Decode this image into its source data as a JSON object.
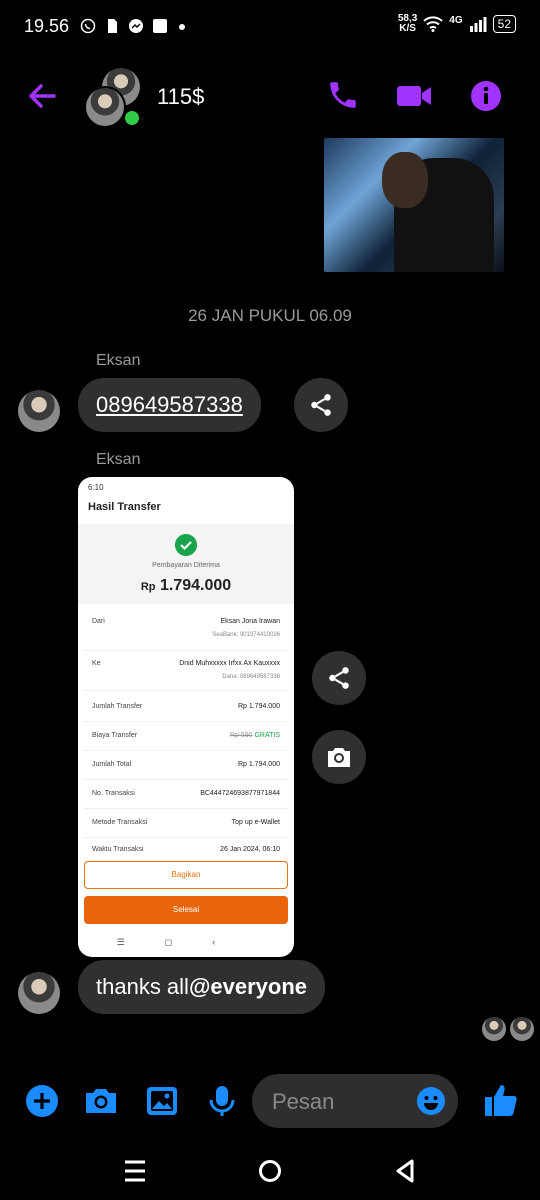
{
  "status_bar": {
    "time": "19.56",
    "net_speed_value": "58,3",
    "net_speed_unit": "K/S",
    "network": "4G",
    "battery": "52"
  },
  "header": {
    "title": "115$",
    "accent_color": "#a033ff"
  },
  "conversation": {
    "date_separator": "26 JAN PUKUL 06.09",
    "messages": [
      {
        "sender": "Eksan",
        "text": "089649587338"
      },
      {
        "sender": "Eksan",
        "type": "image"
      },
      {
        "text_plain": "thanks all",
        "text_mention": "@everyone"
      }
    ]
  },
  "receipt": {
    "status_time": "6:10",
    "title": "Hasil Transfer",
    "received_label": "Pembayaran Diterima",
    "amount_currency": "Rp",
    "amount": "1.794.000",
    "from_label": "Dari",
    "from_name": "Eksan Jona Irawan",
    "from_account": "SeaBank: 901974410026",
    "to_label": "Ke",
    "to_name": "Dnid Muhxxxxx Irfxx Ax Kauxxxx",
    "to_account": "Dana: 089649587338",
    "rows": [
      {
        "label": "Jumlah Transfer",
        "value": "Rp 1.794.000"
      },
      {
        "label": "Biaya Transfer",
        "value": "Rp 590",
        "badge": "GRATIS"
      },
      {
        "label": "Jumlah Total",
        "value": "Rp 1.794.000"
      },
      {
        "label": "No. Transaksi",
        "value": "BC444724693877971844"
      },
      {
        "label": "Metode Transaksi",
        "value": "Top up e-Wallet"
      },
      {
        "label": "Waktu Transaksi",
        "value": "26 Jan 2024, 06:10"
      }
    ],
    "share_button": "Bagikan",
    "done_button": "Selesai",
    "brand_color": "#e8650c"
  },
  "composer": {
    "placeholder": "Pesan",
    "accent_color": "#1a8cff"
  }
}
